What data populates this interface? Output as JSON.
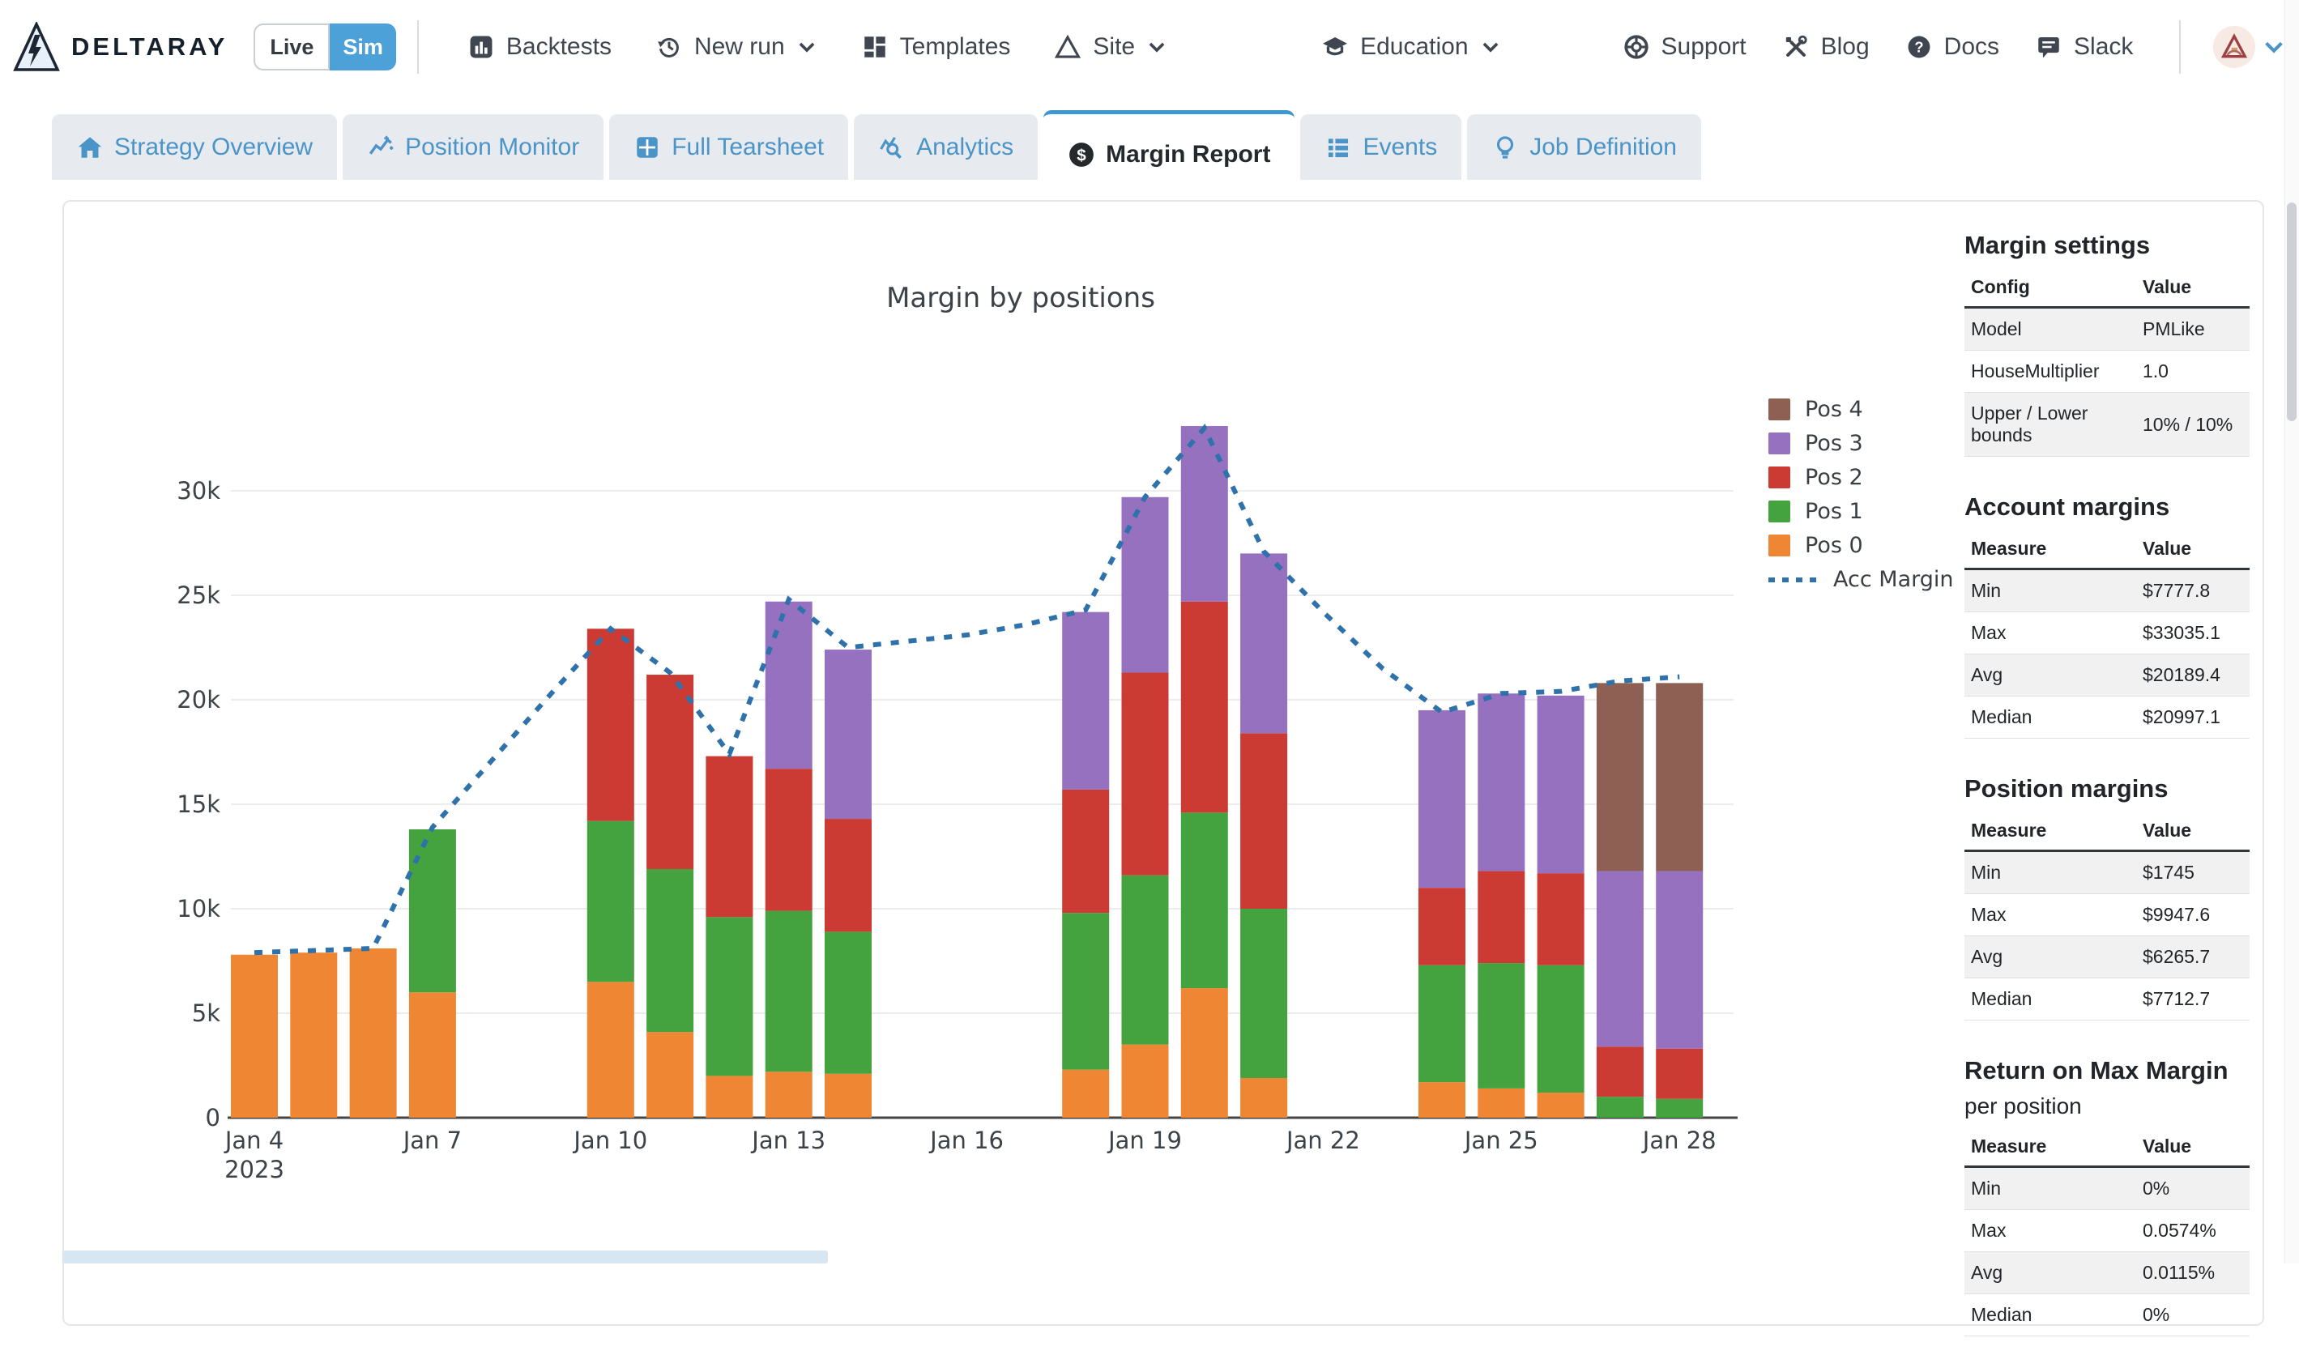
{
  "header": {
    "brand": "DELTARAY",
    "mode_toggle": {
      "live_label": "Live",
      "sim_label": "Sim",
      "active": "Sim",
      "active_color": "#4ba1d8"
    },
    "nav_left": [
      {
        "label": "Backtests",
        "icon": "bar-chart",
        "caret": false
      },
      {
        "label": "New run",
        "icon": "history",
        "caret": true
      },
      {
        "label": "Templates",
        "icon": "grid",
        "caret": false
      },
      {
        "label": "Site",
        "icon": "triangle",
        "caret": true
      }
    ],
    "nav_mid": [
      {
        "label": "Education",
        "icon": "graduation-cap",
        "caret": true
      }
    ],
    "nav_right": [
      {
        "label": "Support",
        "icon": "life-ring",
        "caret": false
      },
      {
        "label": "Blog",
        "icon": "tools",
        "caret": false
      },
      {
        "label": "Docs",
        "icon": "question-circle",
        "caret": false
      },
      {
        "label": "Slack",
        "icon": "chat",
        "caret": false
      }
    ]
  },
  "tabs": [
    {
      "label": "Strategy Overview",
      "icon": "home",
      "active": false
    },
    {
      "label": "Position Monitor",
      "icon": "monitor-line",
      "active": false
    },
    {
      "label": "Full Tearsheet",
      "icon": "tearsheet-grid",
      "active": false
    },
    {
      "label": "Analytics",
      "icon": "analytics-search",
      "active": false
    },
    {
      "label": "Margin Report",
      "icon": "dollar-circle",
      "active": true
    },
    {
      "label": "Events",
      "icon": "list",
      "active": false
    },
    {
      "label": "Job Definition",
      "icon": "lightbulb",
      "active": false
    }
  ],
  "chart_data": {
    "type": "bar",
    "stacked": true,
    "title": "Margin by positions",
    "xlabel": "",
    "ylabel": "",
    "grid": true,
    "legend_position": "right",
    "ylim_k": [
      0,
      34.5
    ],
    "y_ticks": [
      {
        "v": 0,
        "label": "0"
      },
      {
        "v": 5,
        "label": "5k"
      },
      {
        "v": 10,
        "label": "10k"
      },
      {
        "v": 15,
        "label": "15k"
      },
      {
        "v": 20,
        "label": "20k"
      },
      {
        "v": 25,
        "label": "25k"
      },
      {
        "v": 30,
        "label": "30k"
      }
    ],
    "x_ticks": [
      {
        "day": 4,
        "label": "Jan 4",
        "sub": "2023"
      },
      {
        "day": 7,
        "label": "Jan 7"
      },
      {
        "day": 10,
        "label": "Jan 10"
      },
      {
        "day": 13,
        "label": "Jan 13"
      },
      {
        "day": 16,
        "label": "Jan 16"
      },
      {
        "day": 19,
        "label": "Jan 19"
      },
      {
        "day": 22,
        "label": "Jan 22"
      },
      {
        "day": 25,
        "label": "Jan 25"
      },
      {
        "day": 28,
        "label": "Jan 28"
      }
    ],
    "categories_days": [
      4,
      5,
      6,
      7,
      10,
      11,
      12,
      13,
      14,
      18,
      19,
      20,
      21,
      24,
      25,
      26,
      27,
      28
    ],
    "categories_labels": [
      "Jan 4",
      "Jan 5",
      "Jan 6",
      "Jan 7",
      "Jan 10",
      "Jan 11",
      "Jan 12",
      "Jan 13",
      "Jan 14",
      "Jan 18",
      "Jan 19",
      "Jan 20",
      "Jan 21",
      "Jan 24",
      "Jan 25",
      "Jan 26",
      "Jan 27",
      "Jan 28"
    ],
    "series": [
      {
        "name": "Pos 0",
        "color": "#ee8634",
        "values_k": [
          7.8,
          7.9,
          8.1,
          6.0,
          6.5,
          4.1,
          2.0,
          2.2,
          2.1,
          2.3,
          3.5,
          6.2,
          1.9,
          1.7,
          1.4,
          1.2,
          0,
          0
        ]
      },
      {
        "name": "Pos 1",
        "color": "#45a33f",
        "values_k": [
          0,
          0,
          0,
          7.8,
          7.7,
          7.8,
          7.6,
          7.7,
          6.8,
          7.5,
          8.1,
          8.4,
          8.1,
          5.6,
          6.0,
          6.1,
          1.0,
          0.9
        ]
      },
      {
        "name": "Pos 2",
        "color": "#cc3b33",
        "values_k": [
          0,
          0,
          0,
          0,
          9.2,
          9.3,
          7.7,
          6.8,
          5.4,
          5.9,
          9.7,
          10.1,
          8.4,
          3.7,
          4.4,
          4.4,
          2.4,
          2.4
        ]
      },
      {
        "name": "Pos 3",
        "color": "#9671c0",
        "values_k": [
          0,
          0,
          0,
          0,
          0,
          0,
          0,
          8.0,
          8.1,
          8.5,
          8.4,
          8.4,
          8.6,
          8.5,
          8.5,
          8.5,
          8.4,
          8.5
        ]
      },
      {
        "name": "Pos 4",
        "color": "#8d6053",
        "values_k": [
          0,
          0,
          0,
          0,
          0,
          0,
          0,
          0,
          0,
          0,
          0,
          0,
          0,
          0,
          0,
          0,
          9.0,
          9.0
        ]
      }
    ],
    "line_series": {
      "name": "Acc Margin",
      "color": "#2f72ab",
      "style": "dotted",
      "days": [
        4,
        5,
        6,
        7,
        8,
        9,
        10,
        11,
        12,
        13,
        14,
        15,
        16,
        17,
        18,
        19,
        20,
        21,
        22,
        23,
        24,
        25,
        26,
        27,
        28
      ],
      "values_k": [
        7.9,
        8.0,
        8.1,
        13.9,
        17.1,
        20.3,
        23.4,
        21.3,
        17.4,
        24.8,
        22.5,
        22.8,
        23.1,
        23.6,
        24.3,
        29.7,
        33.0,
        27.1,
        24.2,
        21.5,
        19.4,
        20.3,
        20.4,
        20.9,
        21.1
      ]
    }
  },
  "sidebar": {
    "sections": [
      {
        "title": "Margin settings",
        "subtitle": "",
        "columns": [
          "Config",
          "Value"
        ],
        "rows": [
          [
            "Model",
            "PMLike"
          ],
          [
            "HouseMultiplier",
            "1.0"
          ],
          [
            "Upper / Lower bounds",
            "10% / 10%"
          ]
        ]
      },
      {
        "title": "Account margins",
        "subtitle": "",
        "columns": [
          "Measure",
          "Value"
        ],
        "rows": [
          [
            "Min",
            "$7777.8"
          ],
          [
            "Max",
            "$33035.1"
          ],
          [
            "Avg",
            "$20189.4"
          ],
          [
            "Median",
            "$20997.1"
          ]
        ]
      },
      {
        "title": "Position margins",
        "subtitle": "",
        "columns": [
          "Measure",
          "Value"
        ],
        "rows": [
          [
            "Min",
            "$1745"
          ],
          [
            "Max",
            "$9947.6"
          ],
          [
            "Avg",
            "$6265.7"
          ],
          [
            "Median",
            "$7712.7"
          ]
        ]
      },
      {
        "title": "Return on Max Margin",
        "subtitle": "per position",
        "columns": [
          "Measure",
          "Value"
        ],
        "rows": [
          [
            "Min",
            "0%"
          ],
          [
            "Max",
            "0.0574%"
          ],
          [
            "Avg",
            "0.0115%"
          ],
          [
            "Median",
            "0%"
          ]
        ]
      }
    ]
  },
  "colors": {
    "accent_blue": "#4a94c8",
    "active_tab_border": "#3e97d1",
    "sim_bg": "#4ba1d8"
  }
}
